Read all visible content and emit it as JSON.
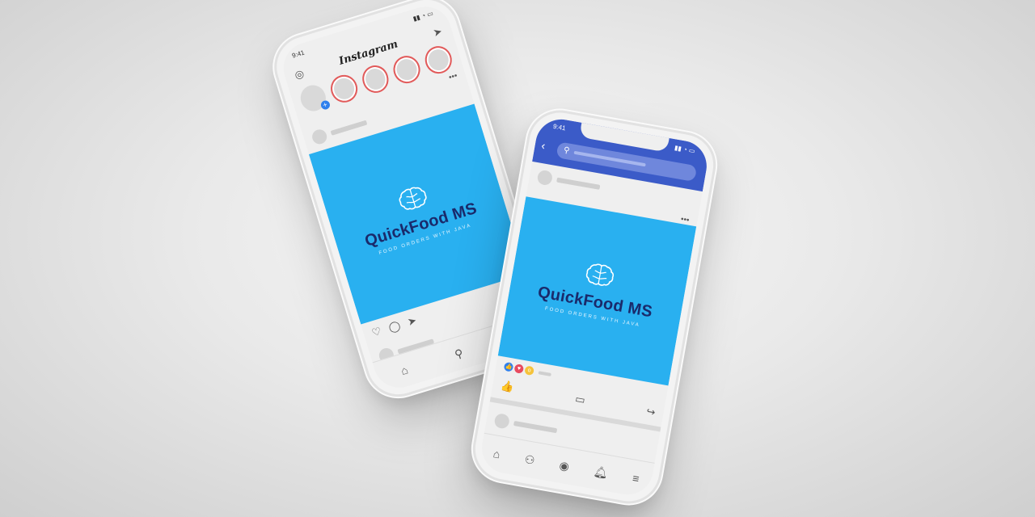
{
  "instagram": {
    "time": "9:41",
    "app_name": "Instagram",
    "post": {
      "brand": "QuickFood MS",
      "tagline": "FOOD ORDERS WITH JAVA"
    }
  },
  "facebook": {
    "time": "9:41",
    "post": {
      "brand": "QuickFood MS",
      "tagline": "FOOD ORDERS WITH JAVA"
    }
  },
  "colors": {
    "post_blue": "#29b0f0",
    "brand_navy": "#1a2a6b",
    "facebook_blue": "#3b5bc8"
  }
}
